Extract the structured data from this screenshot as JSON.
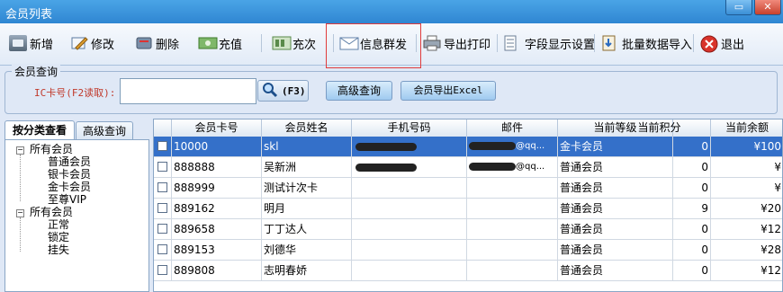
{
  "window": {
    "title": "会员列表",
    "minimize_icon": "restore-icon",
    "close_icon": "close-icon"
  },
  "toolbar": {
    "items": [
      {
        "label": "新增",
        "icon": "add-member-icon"
      },
      {
        "label": "修改",
        "icon": "edit-icon"
      },
      {
        "label": "删除",
        "icon": "delete-icon"
      },
      {
        "label": "充值",
        "icon": "recharge-icon"
      },
      {
        "label": "充次",
        "icon": "recharge-count-icon"
      },
      {
        "label": "信息群发",
        "icon": "mail-icon"
      },
      {
        "label": "导出打印",
        "icon": "printer-icon"
      },
      {
        "label": "字段显示设置",
        "icon": "field-settings-icon"
      },
      {
        "label": "批量数据导入",
        "icon": "import-icon"
      },
      {
        "label": "退出",
        "icon": "exit-icon"
      }
    ]
  },
  "query": {
    "legend": "会员查询",
    "ic_label": "IC卡号(F2读取):",
    "ic_value": "",
    "search_label": "(F3)",
    "advanced_label": "高级查询",
    "export_label": "会员导出Excel"
  },
  "left_panel": {
    "tabs": [
      "按分类查看",
      "高级查询"
    ],
    "tree": {
      "group1": {
        "label": "所有会员",
        "children": [
          "普通会员",
          "银卡会员",
          "金卡会员",
          "至尊VIP"
        ]
      },
      "group2": {
        "label": "所有会员",
        "children": [
          "正常",
          "锁定",
          "挂失"
        ]
      }
    }
  },
  "grid": {
    "columns": [
      "会员卡号",
      "会员姓名",
      "手机号码",
      "邮件",
      "当前等级",
      "当前积分",
      "当前余额"
    ],
    "rows": [
      {
        "card": "10000",
        "name": "skl",
        "email_suffix": "@qq...",
        "level": "金卡会员",
        "points": "0",
        "balance": "¥100"
      },
      {
        "card": "888888",
        "name": "吴新洲",
        "email_suffix": "@qq...",
        "level": "普通会员",
        "points": "0",
        "balance": "¥"
      },
      {
        "card": "888999",
        "name": "测试计次卡",
        "email_suffix": "",
        "level": "普通会员",
        "points": "0",
        "balance": "¥"
      },
      {
        "card": "889162",
        "name": "明月",
        "email_suffix": "",
        "level": "普通会员",
        "points": "9",
        "balance": "¥20"
      },
      {
        "card": "889658",
        "name": "丁丁达人",
        "email_suffix": "",
        "level": "普通会员",
        "points": "0",
        "balance": "¥12"
      },
      {
        "card": "889153",
        "name": "刘德华",
        "email_suffix": "",
        "level": "普通会员",
        "points": "0",
        "balance": "¥28"
      },
      {
        "card": "889808",
        "name": "志明春娇",
        "email_suffix": "",
        "level": "普通会员",
        "points": "0",
        "balance": "¥12"
      }
    ]
  }
}
